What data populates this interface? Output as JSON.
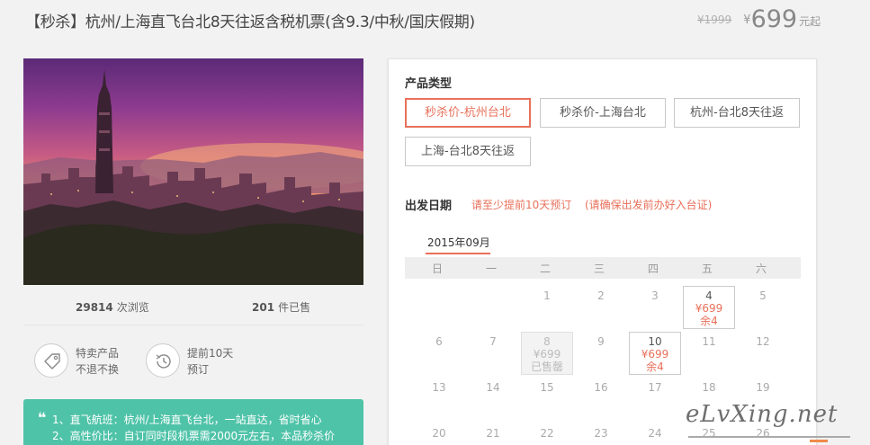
{
  "header": {
    "title": "【秒杀】杭州/上海直飞台北8天往返含税机票(含9.3/中秋/国庆假期)",
    "old_price": "¥1999",
    "currency_symbol": "¥",
    "price": "699",
    "price_unit": "元起"
  },
  "stats": {
    "views_count": "29814",
    "views_label": "次浏览",
    "sold_count": "201",
    "sold_label": "件已售"
  },
  "features": [
    {
      "icon": "tag-icon",
      "line1": "特卖产品",
      "line2": "不退不换"
    },
    {
      "icon": "history-clock-icon",
      "line1": "提前10天",
      "line2": "预订"
    }
  ],
  "highlights": [
    "1、直飞航班：杭州/上海直飞台北，一站直达，省时省心",
    "2、高性价比：自订同时段机票需2000元左右，本品秒杀价"
  ],
  "product_type": {
    "title": "产品类型",
    "options": [
      "秒杀价-杭州台北",
      "秒杀价-上海台北",
      "杭州-台北8天往返",
      "上海-台北8天往返"
    ],
    "selected": 0
  },
  "departure": {
    "title": "出发日期",
    "note1": "请至少提前10天预订",
    "note2": "(请确保出发前办好入台证)"
  },
  "calendar": {
    "month": "2015年09月",
    "weekdays": [
      "日",
      "一",
      "二",
      "三",
      "四",
      "五",
      "六"
    ],
    "rows": [
      [
        "",
        "",
        "1",
        "2",
        "3",
        "4",
        "5"
      ],
      [
        "6",
        "7",
        "8",
        "9",
        "10",
        "11",
        "12"
      ],
      [
        "13",
        "14",
        "15",
        "16",
        "17",
        "18",
        "19"
      ],
      [
        "20",
        "21",
        "22",
        "23",
        "24",
        "25",
        "26"
      ]
    ],
    "available": [
      {
        "day": "4",
        "price": "¥699",
        "status": "余4"
      },
      {
        "day": "8",
        "price": "¥699",
        "status": "已售罄"
      },
      {
        "day": "10",
        "price": "¥699",
        "status": "余4"
      }
    ]
  },
  "watermark": "eLvXing.net",
  "colors": {
    "accent": "#e8705a",
    "highlight_bg": "#4fc3a8"
  }
}
